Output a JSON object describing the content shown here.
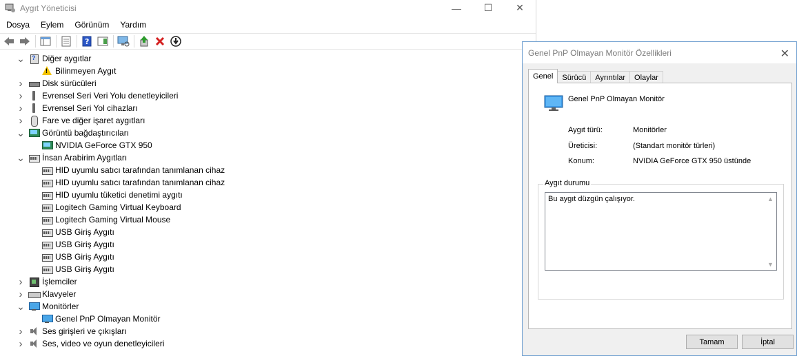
{
  "main_window": {
    "title": "Aygıt Yöneticisi",
    "controls": {
      "minimize": "—",
      "maximize": "☐",
      "close": "✕"
    },
    "menu": [
      "Dosya",
      "Eylem",
      "Görünüm",
      "Yardım"
    ]
  },
  "tree": [
    {
      "label": "Diğer aygıtlar",
      "level": 0,
      "expanded": true,
      "icon": "other-devices-icon"
    },
    {
      "label": "Bilinmeyen Aygıt",
      "level": 1,
      "icon": "warning-device-icon"
    },
    {
      "label": "Disk sürücüleri",
      "level": 0,
      "expanded": false,
      "icon": "disk-drive-icon"
    },
    {
      "label": "Evrensel Seri Veri Yolu denetleyicileri",
      "level": 0,
      "expanded": false,
      "icon": "usb-controller-icon"
    },
    {
      "label": "Evrensel Seri Yol cihazları",
      "level": 0,
      "expanded": false,
      "icon": "usb-device-icon"
    },
    {
      "label": "Fare ve diğer işaret aygıtları",
      "level": 0,
      "expanded": false,
      "icon": "mouse-icon"
    },
    {
      "label": "Görüntü bağdaştırıcıları",
      "level": 0,
      "expanded": true,
      "icon": "display-adapter-icon"
    },
    {
      "label": "NVIDIA GeForce GTX 950",
      "level": 1,
      "icon": "display-adapter-icon"
    },
    {
      "label": "İnsan Arabirim Aygıtları",
      "level": 0,
      "expanded": true,
      "icon": "hid-icon"
    },
    {
      "label": "HID uyumlu satıcı tarafından tanımlanan cihaz",
      "level": 1,
      "icon": "hid-icon"
    },
    {
      "label": "HID uyumlu satıcı tarafından tanımlanan cihaz",
      "level": 1,
      "icon": "hid-icon"
    },
    {
      "label": "HID uyumlu tüketici denetimi aygıtı",
      "level": 1,
      "icon": "hid-icon"
    },
    {
      "label": "Logitech Gaming Virtual Keyboard",
      "level": 1,
      "icon": "hid-icon"
    },
    {
      "label": "Logitech Gaming Virtual Mouse",
      "level": 1,
      "icon": "hid-icon"
    },
    {
      "label": "USB Giriş Aygıtı",
      "level": 1,
      "icon": "hid-icon"
    },
    {
      "label": "USB Giriş Aygıtı",
      "level": 1,
      "icon": "hid-icon"
    },
    {
      "label": "USB Giriş Aygıtı",
      "level": 1,
      "icon": "hid-icon"
    },
    {
      "label": "USB Giriş Aygıtı",
      "level": 1,
      "icon": "hid-icon"
    },
    {
      "label": "İşlemciler",
      "level": 0,
      "expanded": false,
      "icon": "processor-icon"
    },
    {
      "label": "Klavyeler",
      "level": 0,
      "expanded": false,
      "icon": "keyboard-icon"
    },
    {
      "label": "Monitörler",
      "level": 0,
      "expanded": true,
      "icon": "monitor-icon"
    },
    {
      "label": "Genel PnP Olmayan Monitör",
      "level": 1,
      "icon": "monitor-icon"
    },
    {
      "label": "Ses girişleri ve çıkışları",
      "level": 0,
      "expanded": false,
      "icon": "speaker-icon"
    },
    {
      "label": "Ses, video ve oyun denetleyicileri",
      "level": 0,
      "expanded": false,
      "icon": "speaker-icon"
    }
  ],
  "dialog": {
    "title": "Genel PnP Olmayan Monitör Özellikleri",
    "close": "✕",
    "tabs": [
      "Genel",
      "Sürücü",
      "Ayrıntılar",
      "Olaylar"
    ],
    "active_tab": "Genel",
    "device_name": "Genel PnP Olmayan Monitör",
    "props": [
      {
        "label": "Aygıt türü:",
        "value": "Monitörler"
      },
      {
        "label": "Üreticisi:",
        "value": "(Standart monitör türleri)"
      },
      {
        "label": "Konum:",
        "value": "NVIDIA GeForce GTX 950 üstünde"
      }
    ],
    "status_group_label": "Aygıt durumu",
    "status_text": "Bu aygıt düzgün çalışıyor.",
    "ok_label": "Tamam",
    "cancel_label": "İptal"
  }
}
